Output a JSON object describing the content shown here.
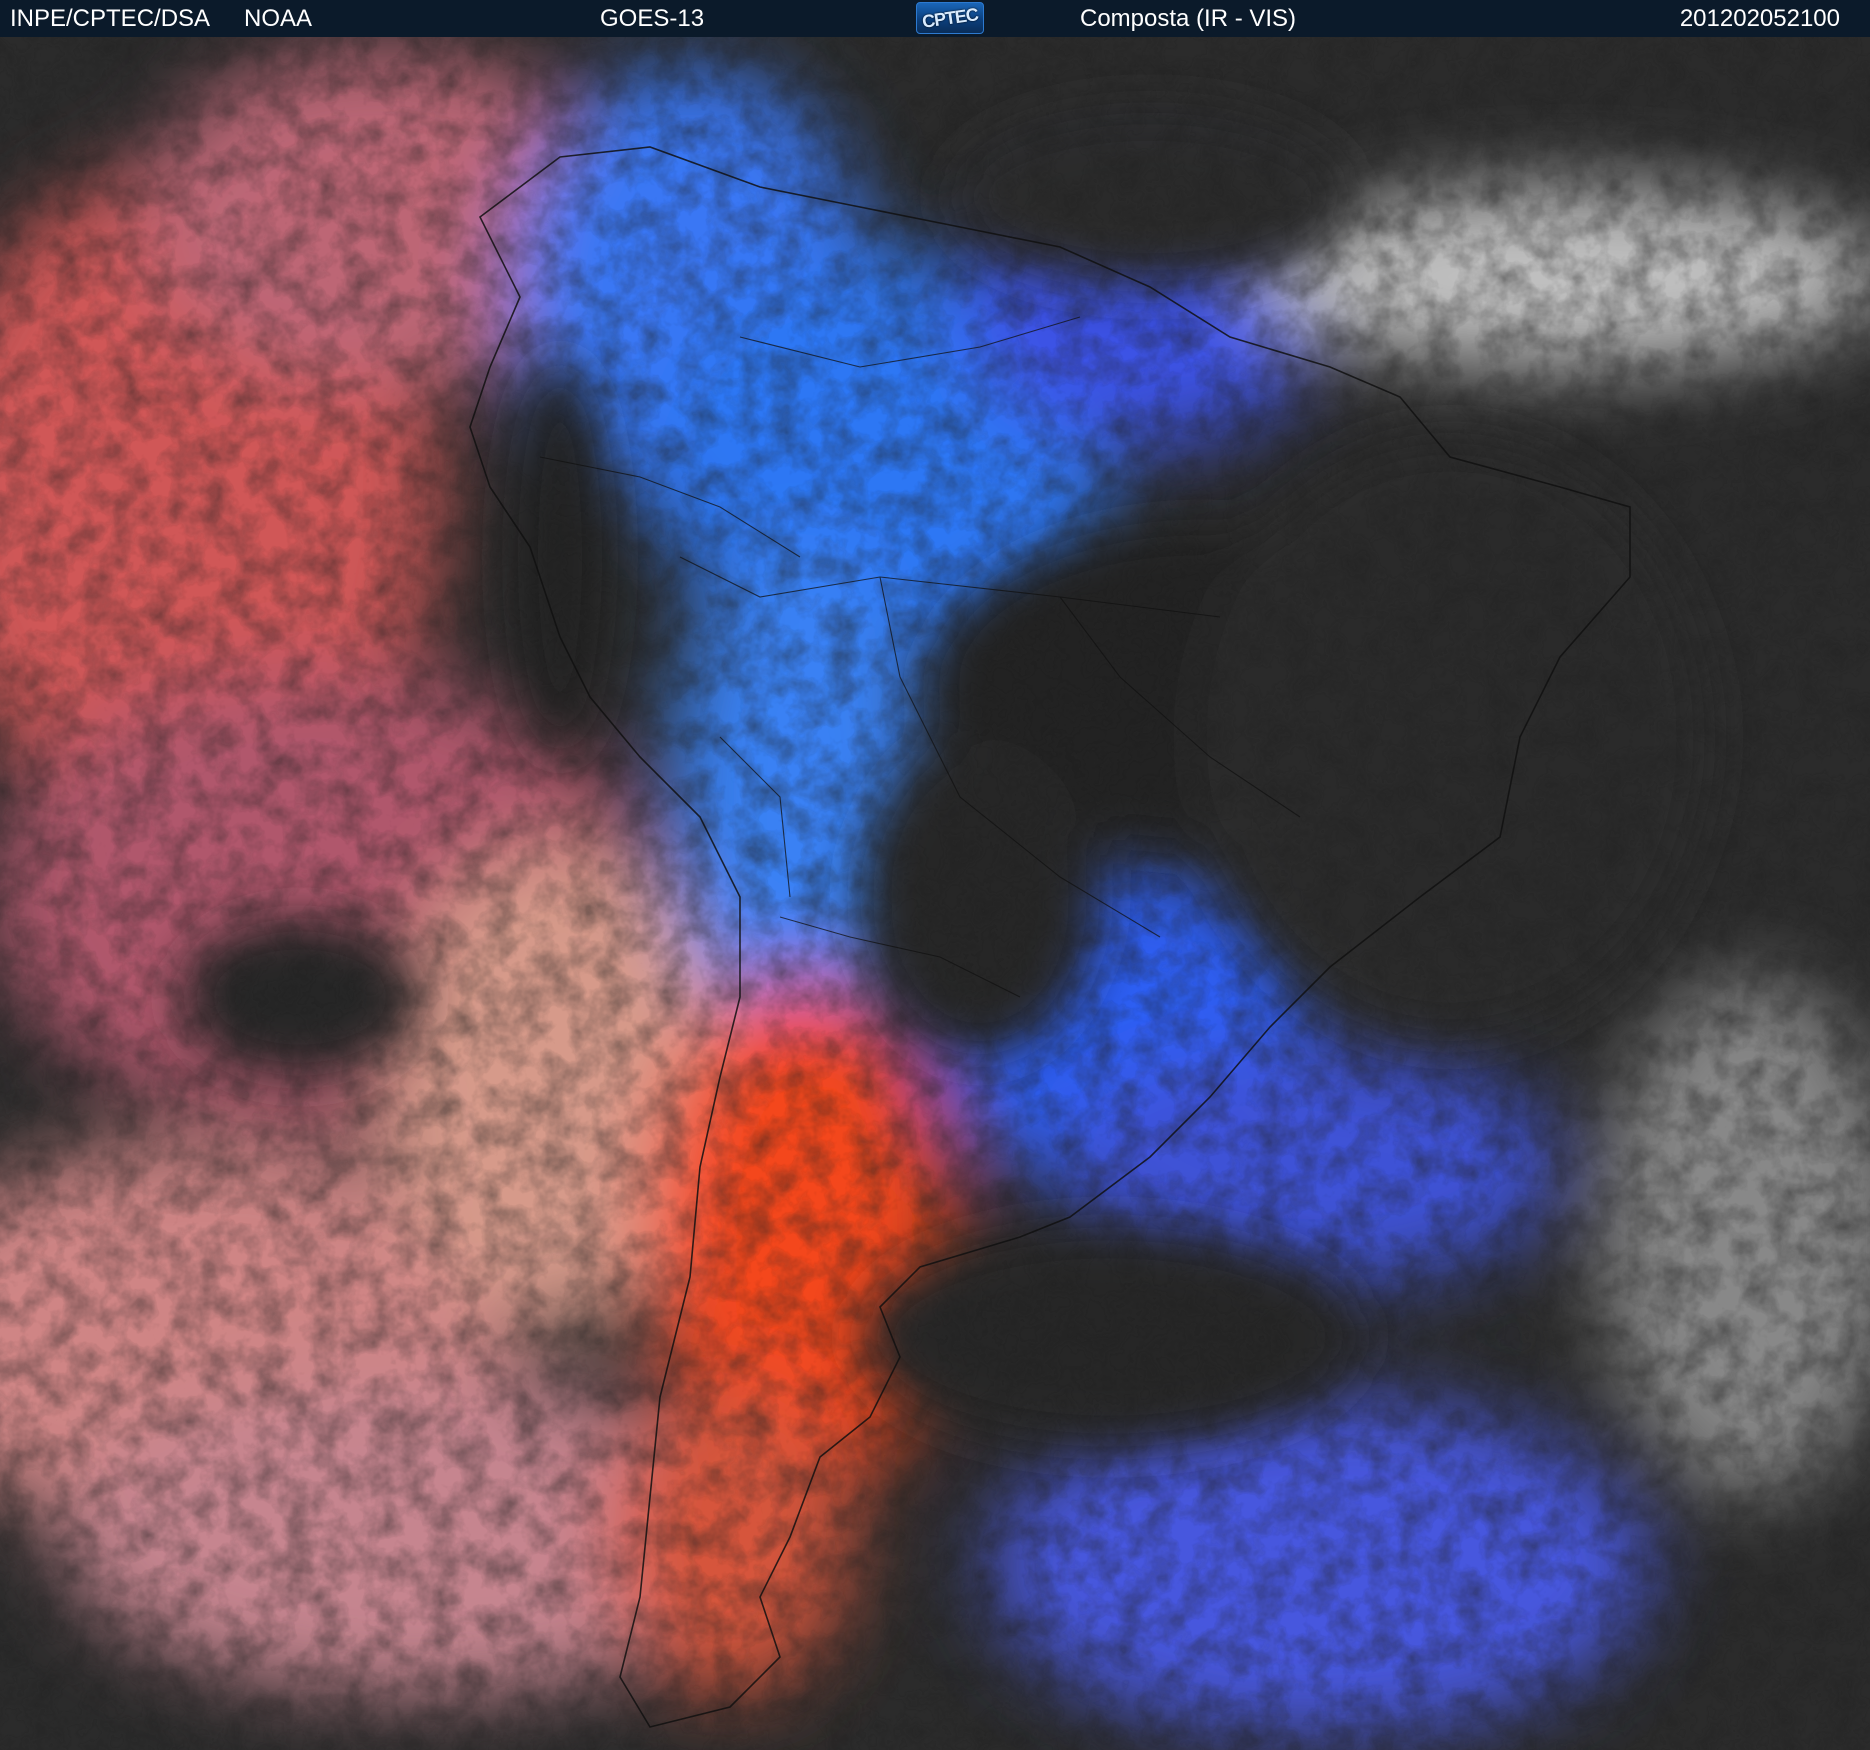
{
  "header": {
    "organization": "INPE/CPTEC/DSA",
    "agency": "NOAA",
    "satellite": "GOES-13",
    "logo_text": "CPTEC",
    "product": "Composta (IR - VIS)",
    "timestamp": "201202052100"
  },
  "imagery": {
    "description_icon": "satellite-composite-image",
    "colors": {
      "background": "#2a2a2a",
      "high_cloud": "#2f6cff",
      "low_cloud_warm": "#d05050",
      "land_warm": "#ff4a1a",
      "ocean_low_cloud": "#c8c8c8",
      "borders": "#111111"
    }
  }
}
